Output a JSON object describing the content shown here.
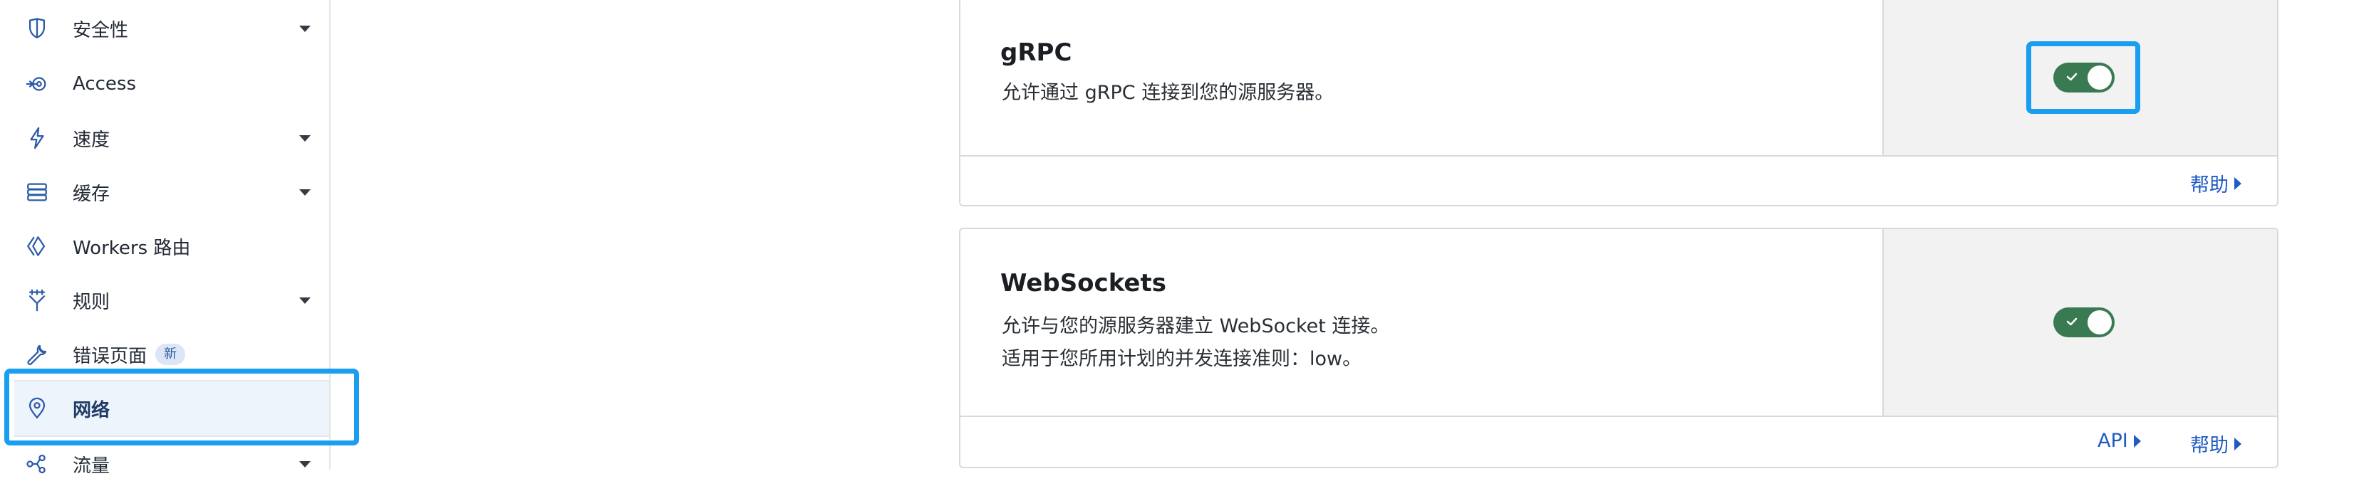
{
  "sidebar": {
    "items": [
      {
        "label": "安全性",
        "icon": "shield-icon",
        "has_caret": true
      },
      {
        "label": "Access",
        "icon": "access-icon",
        "has_caret": false
      },
      {
        "label": "速度",
        "icon": "lightning-icon",
        "has_caret": true
      },
      {
        "label": "缓存",
        "icon": "stack-icon",
        "has_caret": true
      },
      {
        "label": "Workers 路由",
        "icon": "workers-icon",
        "has_caret": false
      },
      {
        "label": "规则",
        "icon": "funnel-icon",
        "has_caret": true
      },
      {
        "label": "错误页面",
        "icon": "wrench-icon",
        "has_caret": false,
        "badge": "新"
      },
      {
        "label": "网络",
        "icon": "location-pin-icon",
        "has_caret": false,
        "active": true
      },
      {
        "label": "流量",
        "icon": "traffic-icon",
        "has_caret": true
      }
    ]
  },
  "cards": {
    "grpc": {
      "title": "gRPC",
      "description": "允许通过 gRPC 连接到您的源服务器。",
      "enabled": true,
      "help_label": "帮助"
    },
    "websockets": {
      "title": "WebSockets",
      "description_line1": "允许与您的源服务器建立 WebSocket 连接。",
      "description_line2": "适用于您所用计划的并发连接准则：low。",
      "enabled": true,
      "api_label": "API",
      "help_label": "帮助"
    }
  },
  "colors": {
    "accent_link": "#1f5bc4",
    "toggle_on": "#3a7a52",
    "highlight_outline": "#1a9ff0",
    "active_bg": "#eef4fc"
  }
}
